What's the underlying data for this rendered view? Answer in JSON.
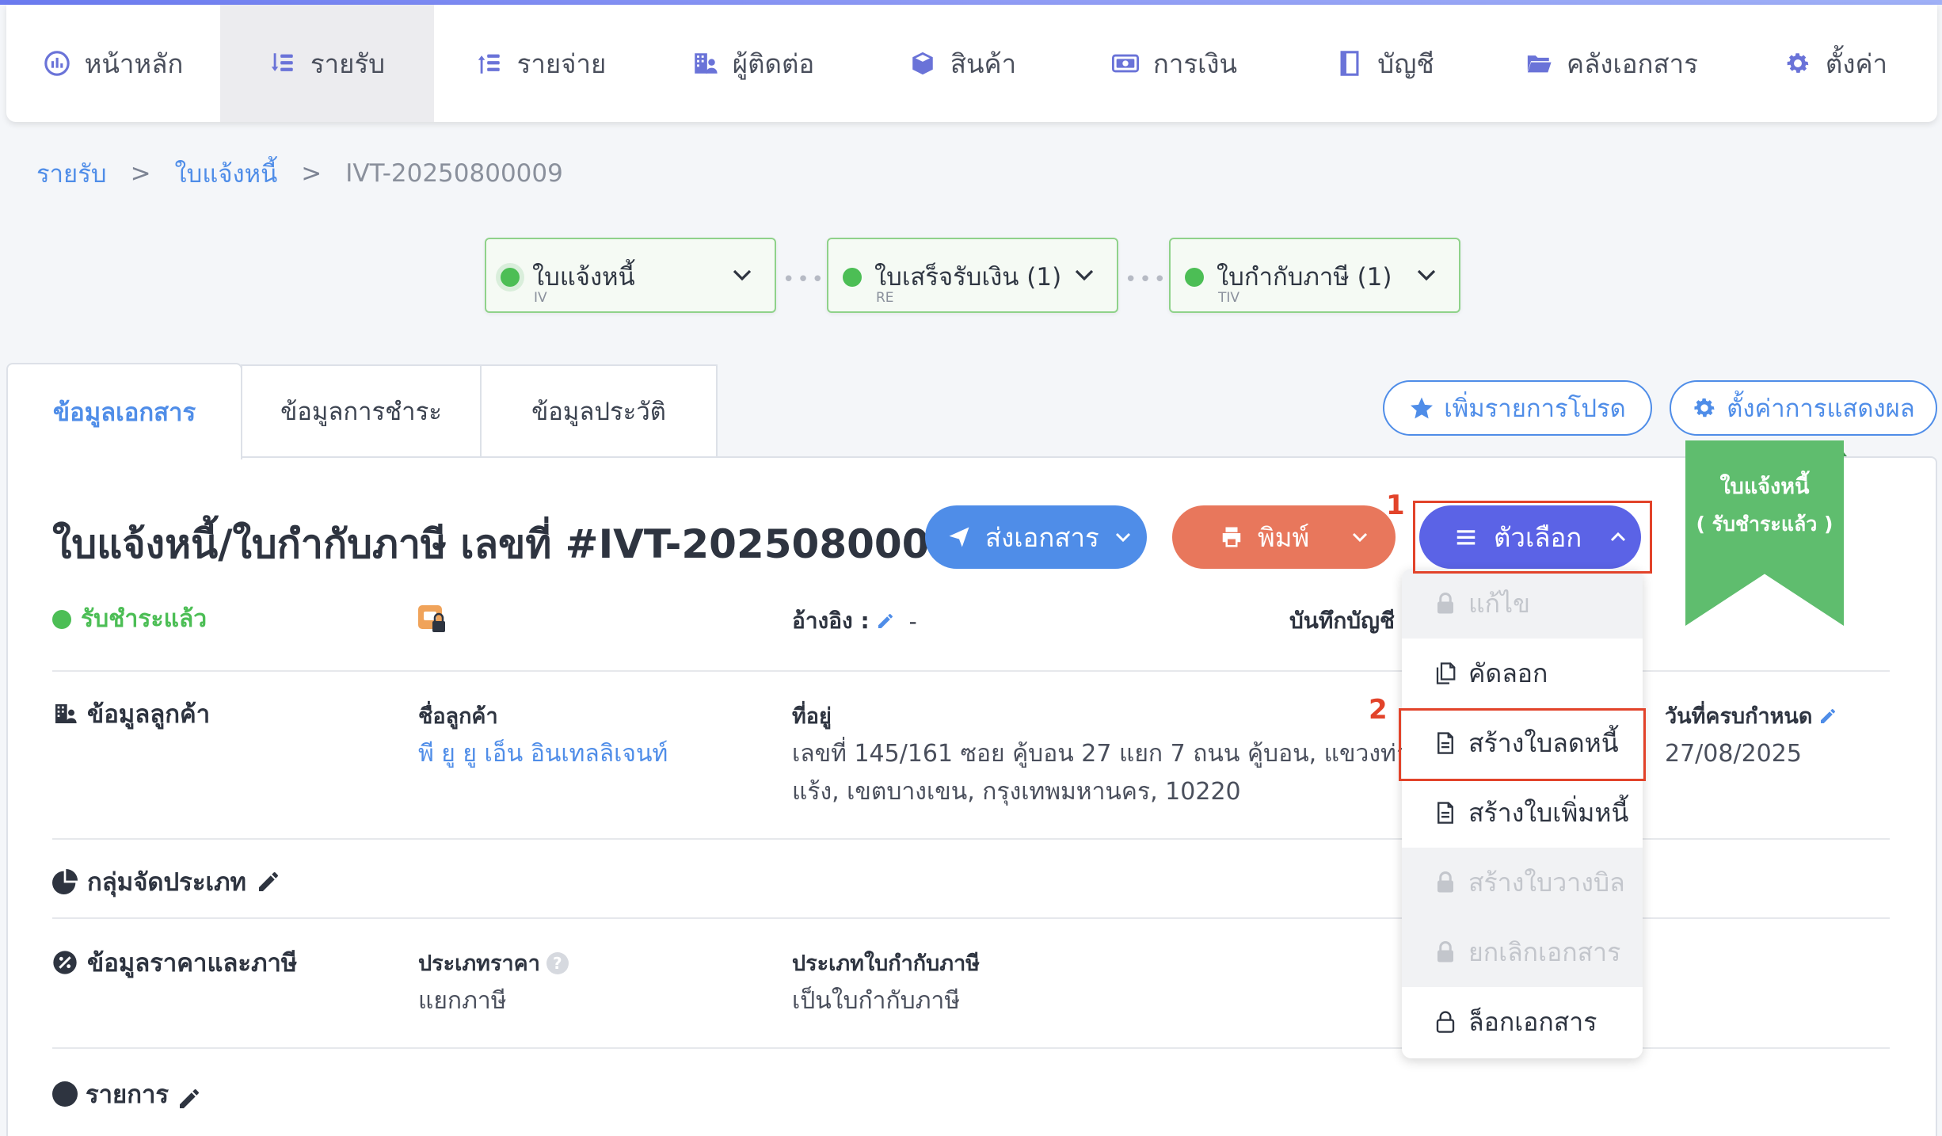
{
  "nav": {
    "items": [
      {
        "label": "หน้าหลัก",
        "icon": "dashboard-icon"
      },
      {
        "label": "รายรับ",
        "icon": "income-icon"
      },
      {
        "label": "รายจ่าย",
        "icon": "expense-icon"
      },
      {
        "label": "ผู้ติดต่อ",
        "icon": "contacts-icon"
      },
      {
        "label": "สินค้า",
        "icon": "product-box-icon"
      },
      {
        "label": "การเงิน",
        "icon": "money-icon"
      },
      {
        "label": "บัญชี",
        "icon": "ledger-book-icon"
      },
      {
        "label": "คลังเอกสาร",
        "icon": "folder-icon"
      },
      {
        "label": "ตั้งค่า",
        "icon": "gear-icon"
      }
    ],
    "active_index": 1
  },
  "breadcrumb": {
    "level1": "รายรับ",
    "sep": ">",
    "level2": "ใบแจ้งหนี้",
    "current": "IVT-20250800009"
  },
  "doc_flow": [
    {
      "title": "ใบแจ้งหนี้",
      "code": "IV"
    },
    {
      "title": "ใบเสร็จรับเงิน (1)",
      "code": "RE"
    },
    {
      "title": "ใบกำกับภาษี (1)",
      "code": "TIV"
    }
  ],
  "tabs": [
    "ข้อมูลเอกสาร",
    "ข้อมูลการชำระ",
    "ข้อมูลประวัติ"
  ],
  "actions": {
    "favorite": "เพิ่มรายการโปรด",
    "display_settings": "ตั้งค่าการแสดงผล",
    "send": "ส่งเอกสาร",
    "print": "พิมพ์",
    "options": "ตัวเลือก"
  },
  "ribbon": {
    "line1": "ใบแจ้งหนี้",
    "line2": "( รับชำระแล้ว )"
  },
  "doc": {
    "title": "ใบแจ้งหนี้/ใบกำกับภาษี เลขที่ #IVT-20250800009",
    "status": "รับชำระแล้ว",
    "ref_label": "อ้างอิง :",
    "ref_value": "-",
    "acct_label": "บันทึกบัญชี :"
  },
  "customer": {
    "section": "ข้อมูลลูกค้า",
    "name_label": "ชื่อลูกค้า",
    "name": "พี ยู ยู เอ็น อินเทลลิเจนท์",
    "address_label": "ที่อยู่",
    "address_line1": "เลขที่ 145/161 ซอย คู้บอน 27 แยก 7 ถนน คู้บอน, แขวงท่า",
    "address_line2": "แร้ง, เขตบางเขน, กรุงเทพมหานคร, 10220",
    "due_label": "วันที่ครบกำหนด",
    "due": "27/08/2025"
  },
  "category": {
    "section": "กลุ่มจัดประเภท"
  },
  "pricing": {
    "section": "ข้อมูลราคาและภาษี",
    "price_type_label": "ประเภทราคา",
    "price_type": "แยกภาษี",
    "tax_doc_label": "ประเภทใบกำกับภาษี",
    "tax_doc": "เป็นใบกำกับภาษี"
  },
  "items": {
    "section": "รายการ"
  },
  "dropdown": [
    {
      "label": "แก้ไข",
      "disabled": true,
      "icon": "lock-icon"
    },
    {
      "label": "คัดลอก",
      "disabled": false,
      "icon": "copy-icon"
    },
    {
      "label": "สร้างใบลดหนี้",
      "disabled": false,
      "icon": "document-icon"
    },
    {
      "label": "สร้างใบเพิ่มหนี้",
      "disabled": false,
      "icon": "document-icon"
    },
    {
      "label": "สร้างใบวางบิล",
      "disabled": true,
      "icon": "lock-icon"
    },
    {
      "label": "ยกเลิกเอกสาร",
      "disabled": true,
      "icon": "lock-icon"
    },
    {
      "label": "ล็อกเอกสาร",
      "disabled": false,
      "icon": "lock-outline-icon"
    }
  ],
  "annotations": {
    "step1": "1",
    "step2": "2"
  },
  "colors": {
    "primary": "#4f8de8",
    "options_button": "#5b63e6",
    "print_button": "#e8775c",
    "send_button": "#4f8de8",
    "paid_green": "#4cbe55",
    "ribbon_green": "#5fbd6e",
    "annotation_red": "#e2432a"
  }
}
